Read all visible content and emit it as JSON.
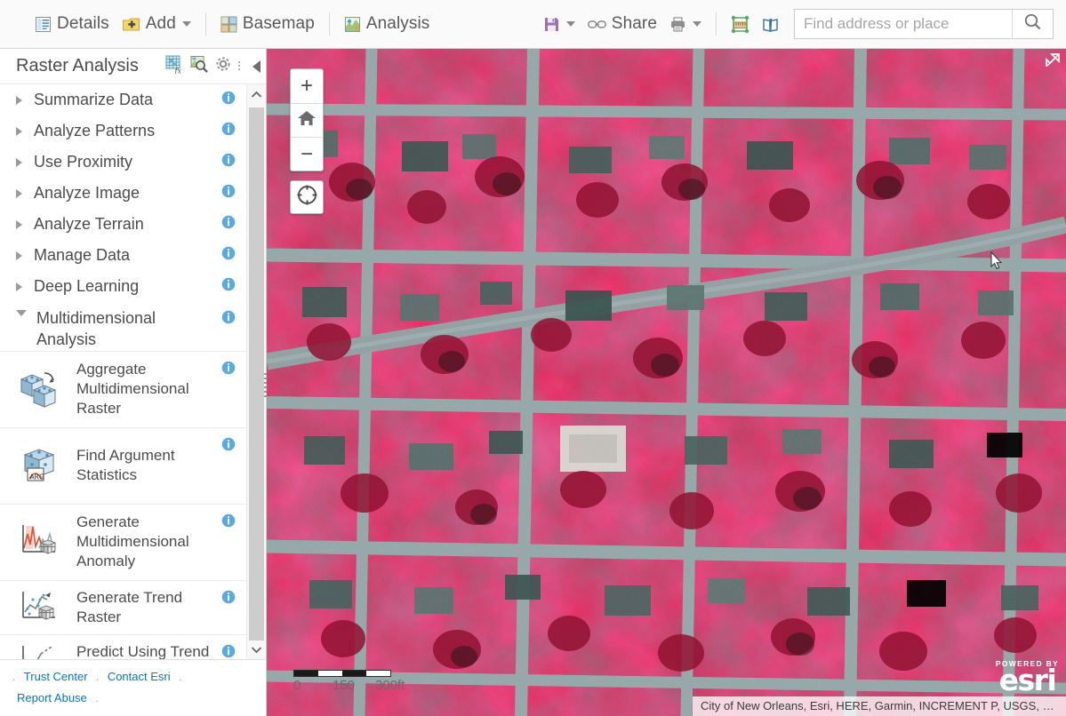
{
  "toolbar": {
    "left_items": [
      {
        "label": "Details",
        "icon": "details-icon"
      },
      {
        "label": "Add",
        "icon": "add-icon",
        "has_caret": true
      },
      {
        "label": "Basemap",
        "icon": "basemap-icon"
      },
      {
        "label": "Analysis",
        "icon": "analysis-icon"
      }
    ],
    "right_items": [
      {
        "label": "",
        "icon": "save-icon",
        "has_caret": true
      },
      {
        "label": "Share",
        "icon": "share-icon"
      },
      {
        "label": "",
        "icon": "print-icon",
        "has_caret": true
      },
      {
        "label": "",
        "icon": "measure-icon"
      },
      {
        "label": "",
        "icon": "bookmarks-icon"
      }
    ],
    "search": {
      "placeholder": "Find address or place",
      "value": "",
      "icon": "search-icon"
    }
  },
  "panel": {
    "title": "Raster Analysis",
    "header_icons": [
      {
        "name": "raster-function-icon"
      },
      {
        "name": "raster-search-icon"
      },
      {
        "name": "settings-gear-icon"
      }
    ],
    "collapse_icon": "collapse-left-icon",
    "categories": [
      {
        "label": "Summarize Data",
        "expanded": false
      },
      {
        "label": "Analyze Patterns",
        "expanded": false
      },
      {
        "label": "Use Proximity",
        "expanded": false
      },
      {
        "label": "Analyze Image",
        "expanded": false
      },
      {
        "label": "Analyze Terrain",
        "expanded": false
      },
      {
        "label": "Manage Data",
        "expanded": false
      },
      {
        "label": "Deep Learning",
        "expanded": false
      },
      {
        "label": "Multidimensional Analysis",
        "expanded": true
      }
    ],
    "tools": [
      {
        "label": "Aggregate Multidimensional Raster",
        "icon": "aggregate-cubes-icon"
      },
      {
        "label": "Find Argument Statistics",
        "icon": "argument-statistics-icon"
      },
      {
        "label": "Generate Multidimensional Anomaly",
        "icon": "anomaly-chart-icon"
      },
      {
        "label": "Generate Trend Raster",
        "icon": "trend-scatter-icon"
      },
      {
        "label": "Predict Using Trend Raster",
        "icon": "predict-trend-icon"
      }
    ],
    "footer_links": [
      "Trust Center",
      "Contact Esri",
      "Report Abuse"
    ],
    "scrollbar": {
      "up_icon": "chevron-up-icon",
      "down_icon": "chevron-down-icon"
    }
  },
  "map": {
    "zoom_in_label": "+",
    "zoom_out_label": "−",
    "home_icon": "home-icon",
    "locate_icon": "locate-crosshair-icon",
    "expand_icon": "expand-map-icon",
    "scalebar": {
      "labels": [
        "0",
        "150",
        "300ft"
      ]
    },
    "attribution": "City of New Orleans, Esri, HERE, Garmin, INCREMENT P, USGS, EPA, …",
    "logo": {
      "powered_by": "POWERED BY",
      "brand": "esri"
    }
  },
  "colors": {
    "accent_blue": "#0079c1",
    "info_blue": "#5ba9e0",
    "toolbar_bg": "#fafafa",
    "text": "#4c4c4c",
    "vegetation_red": "#e8295a",
    "road_gray": "#8f9ea0"
  }
}
